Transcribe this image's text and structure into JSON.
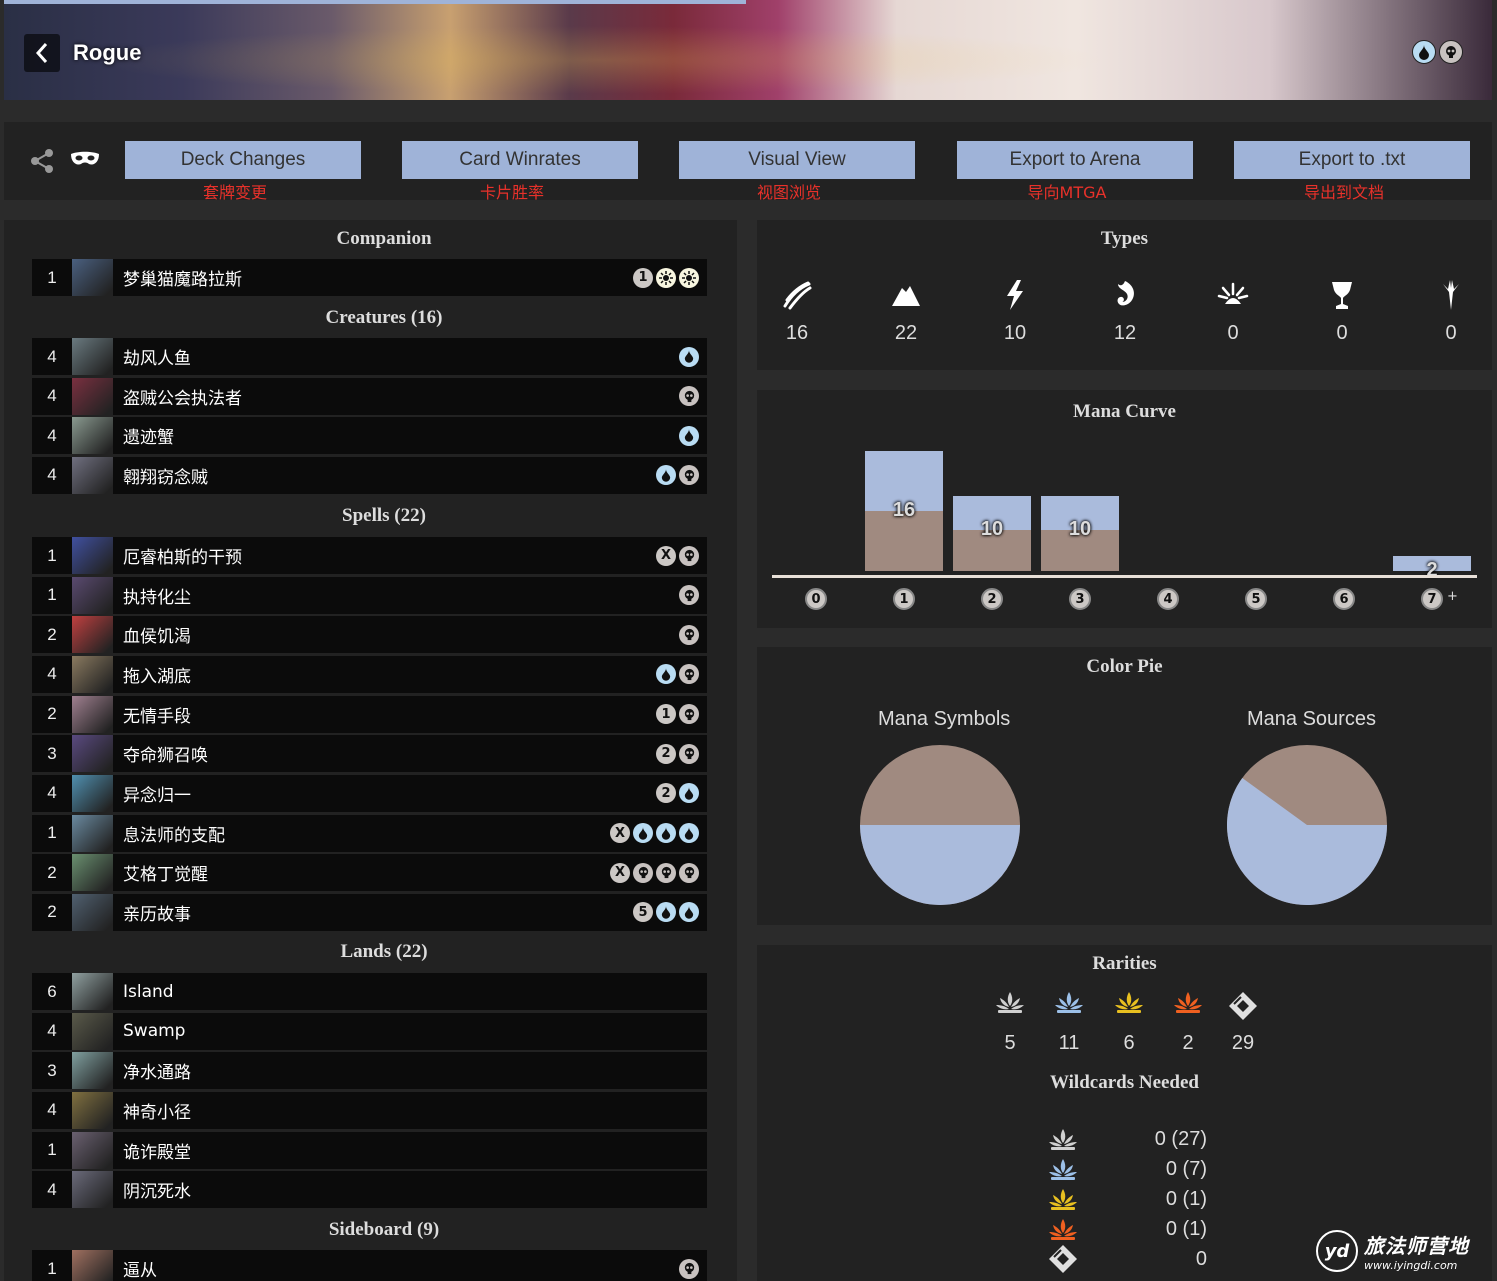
{
  "header": {
    "title": "Rogue",
    "colors": [
      "blue-mana-icon",
      "black-mana-icon"
    ]
  },
  "toolbar": {
    "buttons": [
      {
        "label": "Deck Changes",
        "caption": "套牌变更"
      },
      {
        "label": "Card Winrates",
        "caption": "卡片胜率"
      },
      {
        "label": "Visual View",
        "caption": "视图浏览"
      },
      {
        "label": "Export to Arena",
        "caption": "导向MTGA"
      },
      {
        "label": "Export to .txt",
        "caption": "导出到文档"
      }
    ]
  },
  "deck": {
    "companion": {
      "title": "Companion",
      "cards": [
        {
          "count": "1",
          "name": "梦巢猫魔路拉斯",
          "cost": [
            "1",
            "W",
            "W"
          ],
          "art": "#4a6080"
        }
      ]
    },
    "creatures": {
      "title": "Creatures (16)",
      "cards": [
        {
          "count": "4",
          "name": "劫风人鱼",
          "cost": [
            "U"
          ],
          "art": "#6a7a80"
        },
        {
          "count": "4",
          "name": "盗贼公会执法者",
          "cost": [
            "B"
          ],
          "art": "#7a3040"
        },
        {
          "count": "4",
          "name": "遗迹蟹",
          "cost": [
            "U"
          ],
          "art": "#8a9a90"
        },
        {
          "count": "4",
          "name": "翱翔窃念贼",
          "cost": [
            "U",
            "B"
          ],
          "art": "#707080"
        }
      ]
    },
    "spells": {
      "title": "Spells (22)",
      "cards": [
        {
          "count": "1",
          "name": "厄睿柏斯的干预",
          "cost": [
            "X",
            "B"
          ],
          "art": "#4050a0"
        },
        {
          "count": "1",
          "name": "执持化尘",
          "cost": [
            "B"
          ],
          "art": "#5a4a70"
        },
        {
          "count": "2",
          "name": "血侯饥渴",
          "cost": [
            "B"
          ],
          "art": "#c04040"
        },
        {
          "count": "4",
          "name": "拖入湖底",
          "cost": [
            "U",
            "B"
          ],
          "art": "#8a7a60"
        },
        {
          "count": "2",
          "name": "无情手段",
          "cost": [
            "1",
            "B"
          ],
          "art": "#a08090"
        },
        {
          "count": "3",
          "name": "夺命狮召唤",
          "cost": [
            "2",
            "B"
          ],
          "art": "#5a4a80"
        },
        {
          "count": "4",
          "name": "异念归一",
          "cost": [
            "2",
            "U"
          ],
          "art": "#5090b0"
        },
        {
          "count": "1",
          "name": "息法师的支配",
          "cost": [
            "X",
            "U",
            "U",
            "U"
          ],
          "art": "#6a8aa0"
        },
        {
          "count": "2",
          "name": "艾格丁觉醒",
          "cost": [
            "X",
            "B",
            "B",
            "B"
          ],
          "art": "#6a9070"
        },
        {
          "count": "2",
          "name": "亲历故事",
          "cost": [
            "5",
            "U",
            "U"
          ],
          "art": "#506070"
        }
      ]
    },
    "lands": {
      "title": "Lands (22)",
      "cards": [
        {
          "count": "6",
          "name": "Island",
          "cost": [],
          "art": "#90a0a0"
        },
        {
          "count": "4",
          "name": "Swamp",
          "cost": [],
          "art": "#5a5a4a"
        },
        {
          "count": "3",
          "name": "净水通路",
          "cost": [],
          "art": "#80a0a0"
        },
        {
          "count": "4",
          "name": "神奇小径",
          "cost": [],
          "art": "#807040"
        },
        {
          "count": "1",
          "name": "诡诈殿堂",
          "cost": [],
          "art": "#6a6070"
        },
        {
          "count": "4",
          "name": "阴沉死水",
          "cost": [],
          "art": "#6a6a7a"
        }
      ]
    },
    "sideboard": {
      "title": "Sideboard (9)",
      "cards": [
        {
          "count": "1",
          "name": "逼从",
          "cost": [
            "B"
          ],
          "art": "#a07060"
        }
      ]
    }
  },
  "types": {
    "title": "Types",
    "items": [
      {
        "icon": "creature-icon",
        "count": "16"
      },
      {
        "icon": "land-icon",
        "count": "22"
      },
      {
        "icon": "instant-icon",
        "count": "10"
      },
      {
        "icon": "sorcery-icon",
        "count": "12"
      },
      {
        "icon": "enchantment-icon",
        "count": "0"
      },
      {
        "icon": "artifact-icon",
        "count": "0"
      },
      {
        "icon": "planeswalker-icon",
        "count": "0"
      }
    ]
  },
  "mana_curve": {
    "title": "Mana Curve",
    "labels": [
      "0",
      "1",
      "2",
      "3",
      "4",
      "5",
      "6",
      "7"
    ],
    "plus": "+",
    "bars": [
      {
        "cmc": "1",
        "value": "16",
        "blue_fraction": 0.5
      },
      {
        "cmc": "2",
        "value": "10",
        "blue_fraction": 0.45
      },
      {
        "cmc": "3",
        "value": "10",
        "blue_fraction": 0.45
      },
      {
        "cmc": "7",
        "value": "2",
        "blue_fraction": 1.0
      }
    ]
  },
  "color_pie": {
    "title": "Color Pie",
    "symbols_label": "Mana Symbols",
    "sources_label": "Mana Sources",
    "symbols_blue_fraction": 0.5,
    "sources_blue_fraction": 0.6,
    "blue": "#aabbdc",
    "black": "#a08a80"
  },
  "rarities": {
    "title": "Rarities",
    "items": [
      {
        "icon": "common-icon",
        "count": "5",
        "color": "#d0d0d0"
      },
      {
        "icon": "uncommon-icon",
        "count": "11",
        "color": "#9cc0e8"
      },
      {
        "icon": "rare-icon",
        "count": "6",
        "color": "#e8c020"
      },
      {
        "icon": "mythic-icon",
        "count": "2",
        "color": "#f06020"
      },
      {
        "icon": "token-icon",
        "count": "29",
        "color": "#e0e0e0"
      }
    ],
    "wildcards_title": "Wildcards Needed",
    "wildcards": [
      {
        "icon": "common-icon",
        "value": "0 (27)",
        "color": "#d0d0d0"
      },
      {
        "icon": "uncommon-icon",
        "value": "0 (7)",
        "color": "#9cc0e8"
      },
      {
        "icon": "rare-icon",
        "value": "0 (1)",
        "color": "#e8c020"
      },
      {
        "icon": "mythic-icon",
        "value": "0 (1)",
        "color": "#f06020"
      },
      {
        "icon": "token-icon",
        "value": "0",
        "color": "#e0e0e0"
      }
    ]
  },
  "watermark": {
    "logo": "yd",
    "name": "旅法师营地",
    "url": "www.iyingdi.com"
  }
}
